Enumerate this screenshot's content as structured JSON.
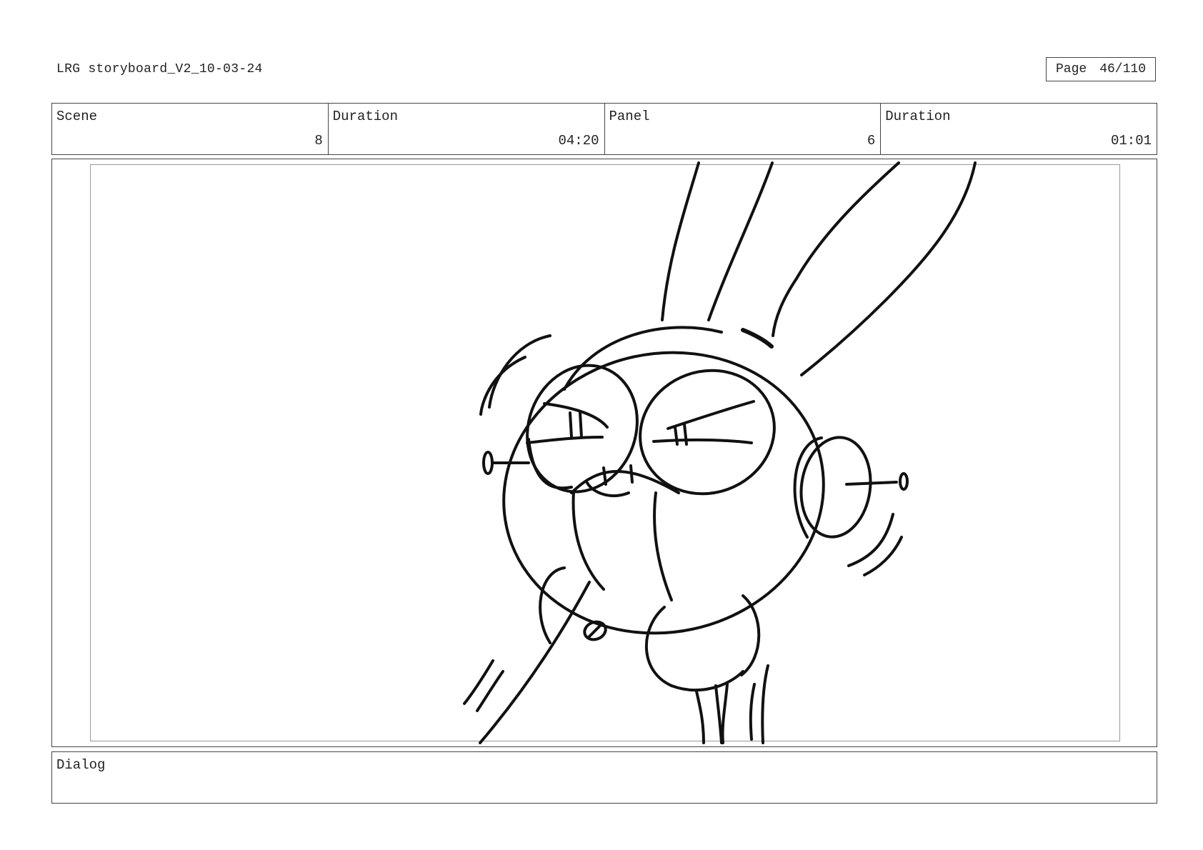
{
  "header": {
    "doc_title": "LRG storyboard_V2_10-03-24",
    "page_label": "Page",
    "page_number": "46/110"
  },
  "info_row": [
    {
      "label": "Scene",
      "value": "8"
    },
    {
      "label": "Duration",
      "value": "04:20"
    },
    {
      "label": "Panel",
      "value": "6"
    },
    {
      "label": "Duration",
      "value": "01:01"
    }
  ],
  "panel": {
    "sketch_icon": "robot-bunny-sketch"
  },
  "dialog": {
    "label": "Dialog",
    "text": ""
  }
}
